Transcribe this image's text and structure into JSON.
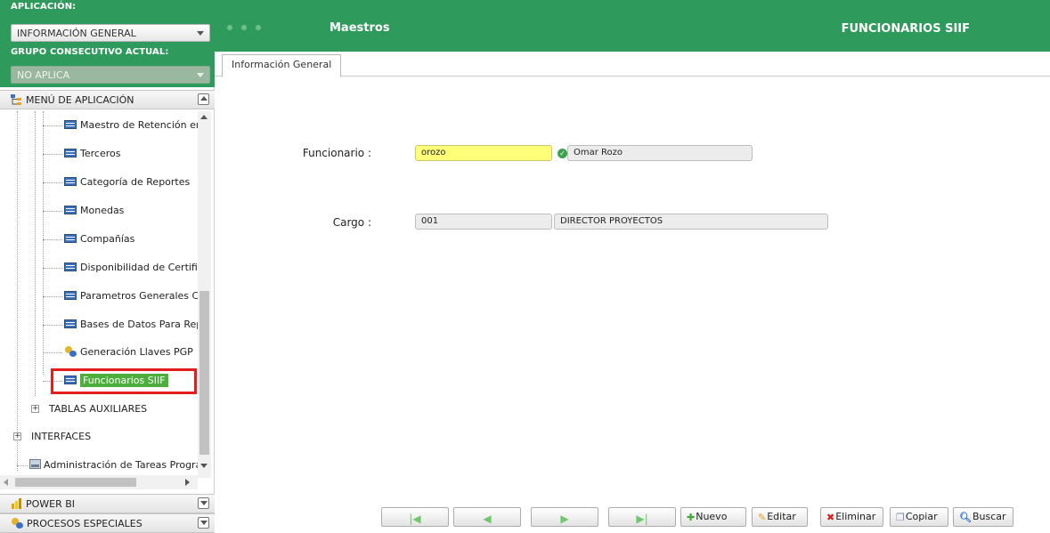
{
  "sidebar": {
    "app_label": "APLICACIÓN:",
    "app_value": "INFORMACIÓN GENERAL",
    "group_label": "GRUPO CONSECUTIVO ACTUAL:",
    "group_value": "NO APLICA",
    "menu_header": "MENÚ DE APLICACIÓN",
    "tree_items": [
      {
        "label": "Maestro de Retención en I",
        "icon": "table-icon"
      },
      {
        "label": "Terceros",
        "icon": "table-icon"
      },
      {
        "label": "Categoría de Reportes",
        "icon": "table-icon"
      },
      {
        "label": "Monedas",
        "icon": "table-icon"
      },
      {
        "label": "Compañías",
        "icon": "table-icon"
      },
      {
        "label": "Disponibilidad de Certifica",
        "icon": "table-icon"
      },
      {
        "label": "Parametros Generales Cry",
        "icon": "table-icon"
      },
      {
        "label": "Bases de Datos Para Repli",
        "icon": "table-icon"
      },
      {
        "label": "Generación Llaves PGP",
        "icon": "key-icon"
      },
      {
        "label": "Funcionarios SIIF",
        "icon": "table-icon",
        "selected": true
      }
    ],
    "folders": [
      {
        "label": "TABLAS AUXILIARES"
      },
      {
        "label": "INTERFACES"
      }
    ],
    "tasks_item": "Administración de Tareas Program",
    "power_bi": "POWER BI",
    "procesos": "PROCESOS ESPECIALES"
  },
  "header": {
    "section": "Maestros",
    "page_title": "FUNCIONARIOS SIIF",
    "bg_color": "#2e9a5b"
  },
  "tabs": [
    "Información General"
  ],
  "form": {
    "funcionario_label": "Funcionario :",
    "funcionario_code": "orozo",
    "funcionario_name": "Omar Rozo",
    "cargo_label": "Cargo :",
    "cargo_code": "001",
    "cargo_name": "DIRECTOR PROYECTOS"
  },
  "toolbar": {
    "first_icon": "first-record-icon",
    "prev_icon": "previous-record-icon",
    "next_icon": "next-record-icon",
    "last_icon": "last-record-icon",
    "new_label": "Nuevo",
    "edit_label": "Editar",
    "delete_label": "Eliminar",
    "copy_label": "Copiar",
    "search_label": "Buscar"
  }
}
